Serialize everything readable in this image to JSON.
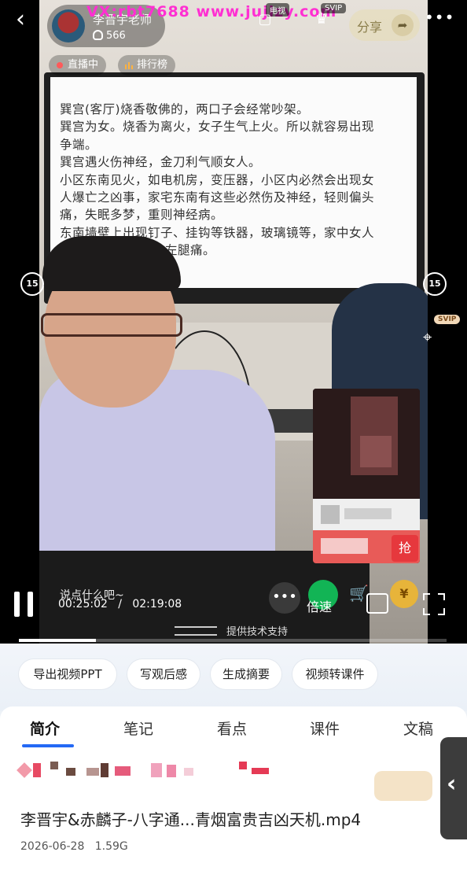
{
  "header": {
    "host_name": "李晋宇老师",
    "viewer_count": "566",
    "watermark": "VX:rbt7688   www.jujizy.com",
    "badges": [
      "电视",
      "SVIP"
    ],
    "share_label": "分享",
    "live_tag": "直播中",
    "rank_tag": "排行榜"
  },
  "slide": {
    "lines": [
      "巽宫(客厅)烧香敬佛的，两口子会经常吵架。",
      "巽宫为女。烧香为离火，女子生气上火。所以就容易出现",
      "争端。",
      "巽宫遇火伤神经，金刀利气顺女人。",
      "小区东南见火，如电机房，变压器，小区内必然会出现女",
      "人爆亡之凶事，家宅东南有这些必然伤及神经，轻则偏头",
      "痛，失眠多梦，重则神经病。",
      "东南墙壁上出现钉子、挂钩等铁器，玻璃镜等，家中女人",
      "       通常是头疼，左腿痛。"
    ]
  },
  "side": {
    "rewind": "15",
    "forward": "15",
    "svip": "SVIP"
  },
  "popup": {
    "grab": "抢"
  },
  "player": {
    "comment_placeholder": "说点什么吧~",
    "current_time": "00:25:02",
    "separator": "/",
    "total_time": "02:19:08",
    "speed_label": "倍速",
    "tech_support": "提供技术支持",
    "progress": 0.18
  },
  "actions": [
    "导出视频PPT",
    "写观后感",
    "生成摘要",
    "视频转课件"
  ],
  "tabs": [
    "简介",
    "笔记",
    "看点",
    "课件",
    "文稿"
  ],
  "active_tab": 0,
  "file": {
    "title": "李晋宇&赤麟子-八字通...青烟富贵吉凶天机.mp4",
    "date": "2026-06-28",
    "size": "1.59G"
  },
  "colors": {
    "accent": "#2469f5",
    "live": "#e6383d",
    "watermark": "#ff2fd2"
  }
}
